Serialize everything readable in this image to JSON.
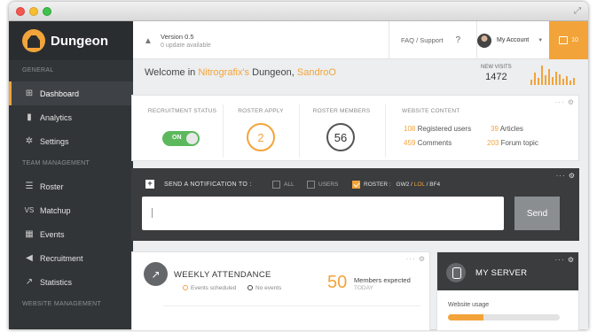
{
  "sidebar": {
    "brand": "Dungeon",
    "sections": {
      "general": "GENERAL",
      "team": "TEAM MANAGEMENT",
      "website": "WEBSITE MANAGEMENT"
    },
    "items": [
      {
        "label": "Dashboard",
        "icon": "dashboard-icon"
      },
      {
        "label": "Analytics",
        "icon": "bar-chart-icon"
      },
      {
        "label": "Settings",
        "icon": "gear-icon"
      },
      {
        "label": "Roster",
        "icon": "list-icon"
      },
      {
        "label": "Matchup",
        "icon": "versus-icon"
      },
      {
        "label": "Events",
        "icon": "calendar-icon"
      },
      {
        "label": "Recruitment",
        "icon": "megaphone-icon"
      },
      {
        "label": "Statistics",
        "icon": "line-chart-icon"
      }
    ],
    "versus_glyph": "VS"
  },
  "topbar": {
    "version": "Version 0.5",
    "update": "0 update available",
    "faq": "FAQ / Support",
    "account": "My Account",
    "notif_count": "10"
  },
  "welcome": {
    "prefix": "Welcome in",
    "site": "Nitrografix's",
    "middle": "Dungeon,",
    "user": "SandroO"
  },
  "visits": {
    "label": "NEW VISITS",
    "value": "1472",
    "spark": [
      6,
      14,
      8,
      22,
      11,
      18,
      9,
      15,
      12,
      7,
      10,
      5,
      8
    ]
  },
  "stats": {
    "recruitment_label": "RECRUITMENT STATUS",
    "recruitment_toggle": "ON",
    "roster_apply_label": "ROSTER APPLY",
    "roster_apply_value": "2",
    "roster_members_label": "ROSTER MEMBERS",
    "roster_members_value": "56",
    "content_label": "WEBSITE CONTENT",
    "content": {
      "users_n": "108",
      "users_l": "Registered users",
      "articles_n": "39",
      "articles_l": "Articles",
      "comments_n": "459",
      "comments_l": "Comments",
      "forum_n": "203",
      "forum_l": "Forum topic"
    }
  },
  "notify": {
    "label": "SEND A NOTIFICATION TO :",
    "all": "ALL",
    "users": "USERS",
    "roster": "ROSTER :",
    "g1": "GW2",
    "sep": "/",
    "g2": "LOL",
    "g3": "BF4",
    "send": "Send"
  },
  "attendance": {
    "title": "WEEKLY ATTENDANCE",
    "legend1": "Events scheduled",
    "legend2": "No events",
    "count": "50",
    "expected": "Members expected",
    "today": "TODAY"
  },
  "server": {
    "title": "MY SERVER",
    "usage_label": "Website usage",
    "usage": 0.32
  },
  "colors": {
    "accent": "#f2a43a",
    "sidebar": "#323538",
    "toggle_on": "#5cb85c"
  }
}
